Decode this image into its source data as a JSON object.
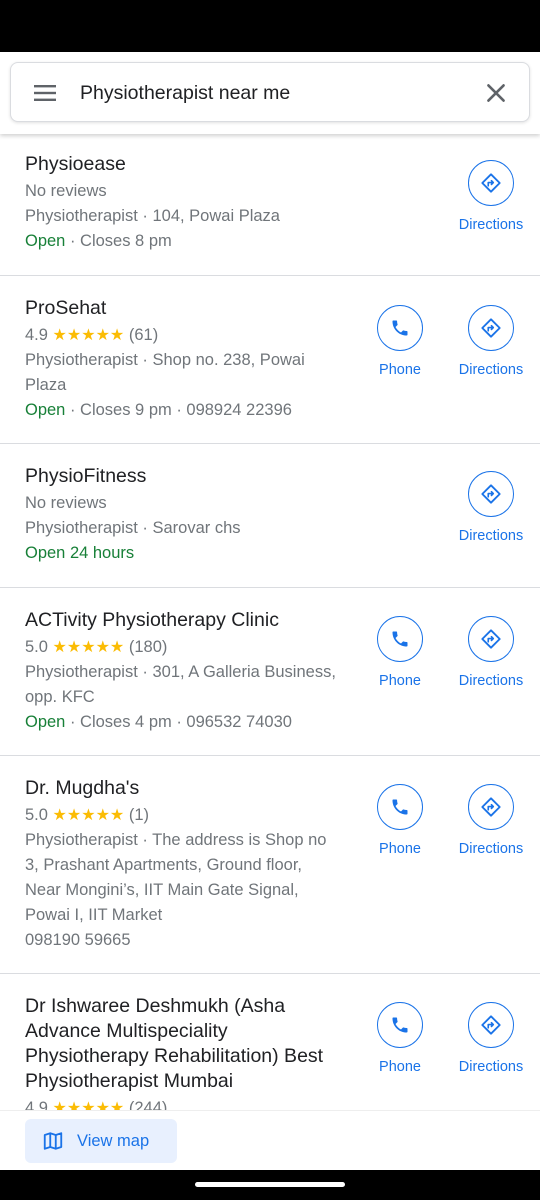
{
  "search": {
    "query": "Physiotherapist near me"
  },
  "results": [
    {
      "name": "Physioease",
      "rating_text": "No reviews",
      "address_lines": [
        "Physiotherapist · 104, Powai Plaza"
      ],
      "open": "Open",
      "hours_rest": " · Closes 8 pm",
      "extra_lines": [],
      "has_phone": false
    },
    {
      "name": "ProSehat",
      "rating": "4.9",
      "stars": "★★★★★",
      "reviews": "(61)",
      "address_lines": [
        "Physiotherapist · Shop no. 238, Powai",
        "Plaza"
      ],
      "open": "Open",
      "hours_rest": " · Closes 9 pm · 098924 22396",
      "extra_lines": [],
      "has_phone": true
    },
    {
      "name": "PhysioFitness",
      "rating_text": "No reviews",
      "address_lines": [
        "Physiotherapist · Sarovar chs"
      ],
      "open": "Open 24 hours",
      "hours_rest": "",
      "extra_lines": [],
      "has_phone": false
    },
    {
      "name": "ACTivity Physiotherapy Clinic",
      "rating": "5.0",
      "stars": "★★★★★",
      "reviews": "(180)",
      "address_lines": [
        "Physiotherapist · 301, A Galleria Business,",
        "opp. KFC"
      ],
      "open": "Open",
      "hours_rest": " · Closes 4 pm · 096532 74030",
      "extra_lines": [],
      "has_phone": true
    },
    {
      "name": "Dr. Mugdha's",
      "rating": "5.0",
      "stars": "★★★★★",
      "reviews": "(1)",
      "address_lines": [
        "Physiotherapist · The address is Shop no",
        "3, Prashant Apartments, Ground floor,",
        "Near Mongini’s, IIT Main Gate Signal,",
        "Powai I, IIT Market"
      ],
      "open": "",
      "hours_rest": "",
      "extra_lines": [
        "098190 59665"
      ],
      "has_phone": true
    },
    {
      "name_lines": [
        "Dr Ishwaree Deshmukh (Asha",
        "Advance Multispeciality",
        "Physiotherapy Rehabilitation) Best",
        "Physiotherapist Mumbai"
      ],
      "rating": "4.9",
      "stars": "★★★★★",
      "reviews": "(244)",
      "address_lines": [],
      "open": "",
      "hours_rest": "",
      "extra_lines": [],
      "has_phone": true
    }
  ],
  "actions": {
    "phone_label": "Phone",
    "directions_label": "Directions"
  },
  "bottom": {
    "view_map_label": "View map"
  },
  "colors": {
    "accent": "#1a73e8",
    "open": "#188038",
    "star": "#fbbc04",
    "secondary_text": "#70757a"
  },
  "icons": {
    "menu": "menu-icon",
    "close": "close-icon",
    "phone": "phone-icon",
    "directions": "directions-icon",
    "map": "map-icon"
  }
}
